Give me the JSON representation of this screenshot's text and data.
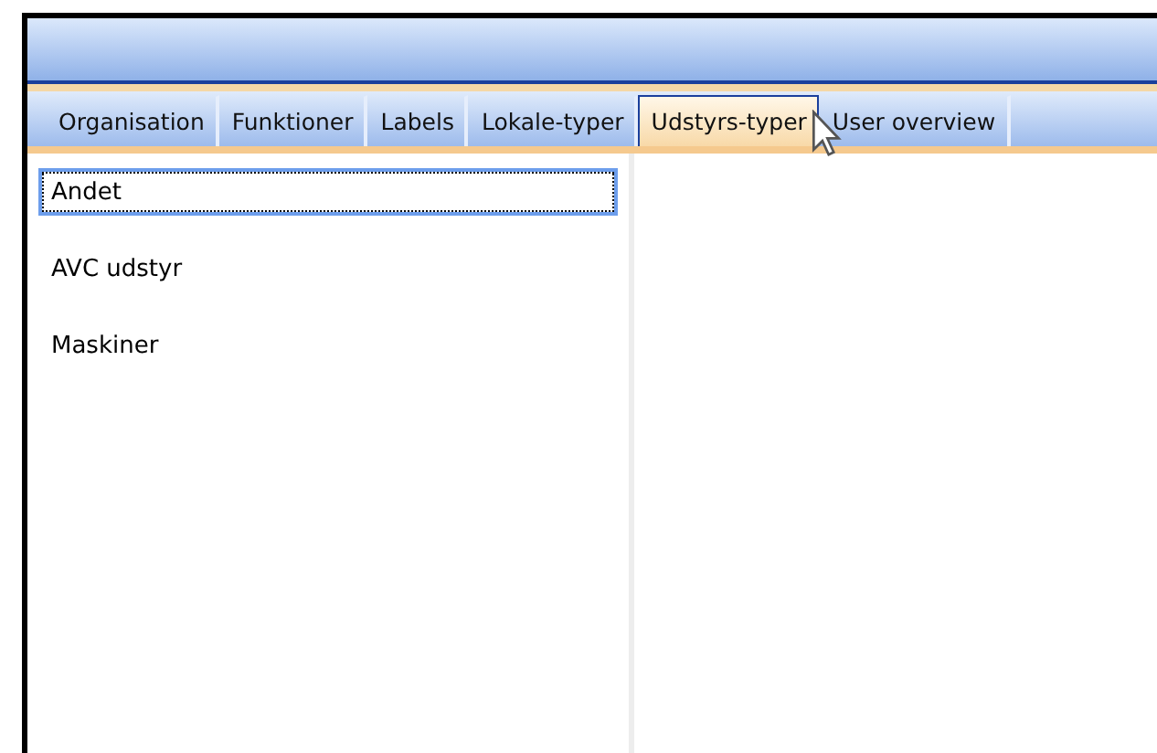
{
  "tabs": [
    {
      "label": "Organisation",
      "selected": false
    },
    {
      "label": "Funktioner",
      "selected": false
    },
    {
      "label": "Labels",
      "selected": false
    },
    {
      "label": "Lokale-typer",
      "selected": false
    },
    {
      "label": "Udstyrs-typer",
      "selected": true
    },
    {
      "label": "User overview",
      "selected": false
    }
  ],
  "list": {
    "items": [
      {
        "label": "Andet",
        "selected": true
      },
      {
        "label": "AVC udstyr",
        "selected": false
      },
      {
        "label": "Maskiner",
        "selected": false
      }
    ]
  }
}
